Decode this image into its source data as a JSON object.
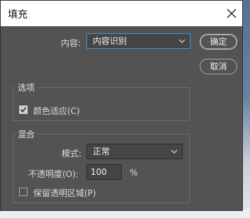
{
  "window": {
    "title": "填充"
  },
  "content": {
    "label": "内容:",
    "value": "内容识别"
  },
  "buttons": {
    "ok": "确定",
    "cancel": "取消"
  },
  "options": {
    "group_title": "选项",
    "color_adapt": {
      "label": "颜色适应(C)",
      "checked": true
    }
  },
  "blending": {
    "group_title": "混合",
    "mode": {
      "label": "模式:",
      "value": "正常"
    },
    "opacity": {
      "label": "不透明度(O):",
      "value": "100",
      "unit": "%"
    },
    "preserve_transparency": {
      "label": "保留透明区域(P)",
      "checked": false
    }
  },
  "colors": {
    "accent": "#3f95d8",
    "dialog_bg": "#535353",
    "titlebar_bg": "#ffffff"
  },
  "icons": {
    "close": "close-icon",
    "dropdown": "chevron-down-icon",
    "check": "check-icon"
  }
}
